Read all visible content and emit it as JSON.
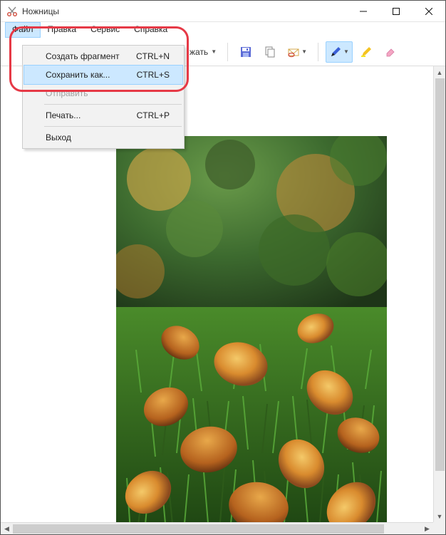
{
  "window": {
    "title": "Ножницы"
  },
  "menubar": {
    "items": [
      {
        "label": "Файл",
        "active": true
      },
      {
        "label": "Правка",
        "active": false
      },
      {
        "label": "Сервис",
        "active": false
      },
      {
        "label": "Справка",
        "active": false
      }
    ]
  },
  "toolbar": {
    "delay_fragment": "жать"
  },
  "dropdown": {
    "items": [
      {
        "label": "Создать фрагмент",
        "shortcut": "CTRL+N",
        "state": "normal"
      },
      {
        "label": "Сохранить как...",
        "shortcut": "CTRL+S",
        "state": "hover"
      },
      {
        "label": "Отправить",
        "shortcut": "",
        "state": "disabled"
      },
      {
        "label": "Печать...",
        "shortcut": "CTRL+P",
        "state": "normal"
      },
      {
        "label": "Выход",
        "shortcut": "",
        "state": "normal"
      }
    ]
  },
  "colors": {
    "hoverBg": "#cce8ff",
    "hoverBorder": "#99d1ff",
    "annotation": "#e63946"
  },
  "image": {
    "description": "Photograph of autumn leaves on green grass, shallow depth of field"
  }
}
